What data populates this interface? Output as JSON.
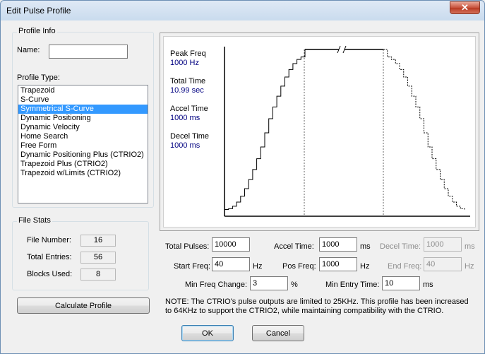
{
  "window": {
    "title": "Edit Pulse Profile",
    "close_glyph": "✕"
  },
  "profile_info": {
    "group_label": "Profile Info",
    "name_label": "Name:",
    "name_value": "",
    "type_label": "Profile Type:",
    "types": [
      "Trapezoid",
      "S-Curve",
      "Symmetrical S-Curve",
      "Dynamic Positioning",
      "Dynamic Velocity",
      "Home Search",
      "Free Form",
      "Dynamic Positioning Plus (CTRIO2)",
      "Trapezoid Plus (CTRIO2)",
      "Trapezoid w/Limits (CTRIO2)"
    ],
    "selected_index": 2
  },
  "file_stats": {
    "group_label": "File Stats",
    "file_number_label": "File Number:",
    "file_number": "16",
    "total_entries_label": "Total Entries:",
    "total_entries": "56",
    "blocks_used_label": "Blocks Used:",
    "blocks_used": "8"
  },
  "calculate_label": "Calculate Profile",
  "chart_readout": {
    "peak_freq_label": "Peak Freq",
    "peak_freq": "1000 Hz",
    "total_time_label": "Total Time",
    "total_time": "10.99 sec",
    "accel_time_label": "Accel Time",
    "accel_time": "1000 ms",
    "decel_time_label": "Decel Time",
    "decel_time": "1000 ms"
  },
  "chart_data": {
    "type": "line",
    "shape": "symmetrical-s-curve",
    "peak_freq": 1000,
    "start_freq": 40,
    "accel_ms": 1000,
    "decel_ms": 1000,
    "axis_break": true,
    "ylim": [
      0,
      1000
    ],
    "series": [
      {
        "x": [
          0.0,
          0.05,
          0.1,
          0.15,
          0.2,
          0.25,
          0.3,
          0.35,
          0.4,
          0.45,
          0.5,
          0.55,
          0.6,
          0.65,
          0.7,
          0.75,
          0.8,
          0.85,
          0.9,
          0.95,
          1.0
        ],
        "values": [
          40,
          45,
          60,
          85,
          120,
          165,
          220,
          280,
          345,
          415,
          500,
          585,
          655,
          720,
          780,
          835,
          880,
          915,
          940,
          955,
          1000
        ]
      }
    ]
  },
  "settings": {
    "total_pulses_label": "Total Pulses:",
    "total_pulses": "10000",
    "accel_time_label": "Accel Time:",
    "accel_time": "1000",
    "accel_unit": "ms",
    "decel_time_label": "Decel Time:",
    "decel_time": "1000",
    "decel_unit": "ms",
    "start_freq_label": "Start Freq:",
    "start_freq": "40",
    "start_unit": "Hz",
    "pos_freq_label": "Pos Freq:",
    "pos_freq": "1000",
    "pos_unit": "Hz",
    "end_freq_label": "End Freq:",
    "end_freq": "40",
    "end_unit": "Hz",
    "min_freq_change_label": "Min Freq Change:",
    "min_freq_change": "3",
    "min_freq_unit": "%",
    "min_entry_time_label": "Min Entry Time:",
    "min_entry_time": "10",
    "min_entry_unit": "ms"
  },
  "note": "NOTE: The CTRIO's pulse outputs are limited to 25KHz. This profile has been increased to 64KHz to support the CTRIO2, while maintaining compatibility with the CTRIO.",
  "buttons": {
    "ok": "OK",
    "cancel": "Cancel"
  }
}
